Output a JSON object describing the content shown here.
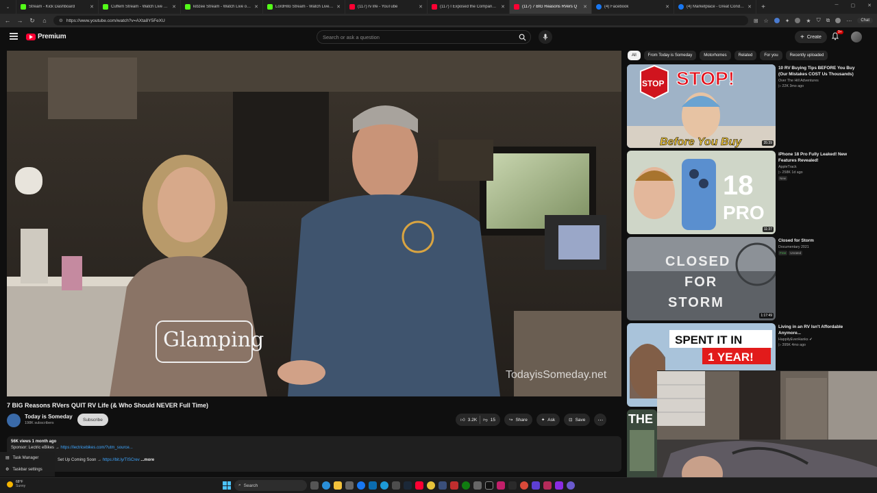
{
  "browser": {
    "tabs": [
      {
        "label": "Stream - Kick Dashboard",
        "fav": "k",
        "active": false
      },
      {
        "label": "Cuffem Stream - Watch Live on Ki",
        "fav": "k",
        "active": false
      },
      {
        "label": "kibzee Stream - Watch Live on Ki",
        "fav": "k",
        "active": false
      },
      {
        "label": "LordHito Stream - Watch Live on",
        "fav": "k",
        "active": false
      },
      {
        "label": "(117) rv life - YouTube",
        "fav": "y",
        "active": false
      },
      {
        "label": "(117) I Exposed the Company Spy",
        "fav": "y",
        "active": false
      },
      {
        "label": "(117) 7 BIG Reasons RVers Q",
        "fav": "y",
        "active": true
      },
      {
        "label": "(4) Facebook",
        "fav": "f",
        "active": false
      },
      {
        "label": "(4) Marketplace - Great Conditio",
        "fav": "f",
        "active": false
      }
    ],
    "url": "https://www.youtube.com/watch?v=AXta8Y5FeXU",
    "chat_label": "Chat"
  },
  "header": {
    "logo_text": "Premium",
    "search_placeholder": "Search or ask a question",
    "create_label": "Create",
    "notif_badge": "9+"
  },
  "video": {
    "watermark": "TodayisSomeday.net",
    "title": "7 BIG Reasons RVers QUIT RV Life (& Who Should NEVER Full Time)",
    "channel": "Today is Someday",
    "subscribers": "198K subscribers",
    "subscribe_label": "Subscribe",
    "likes": "3.2K",
    "dislikes": "15",
    "share_label": "Share",
    "ask_label": "Ask",
    "save_label": "Save"
  },
  "description": {
    "stats": "56K views  1 month ago",
    "line1_text": "Sponsor: Lectric eBikes → ",
    "line1_link": "https://lectricebikes.com/?utm_source...",
    "line2_text": "Set Up Coming Soon → ",
    "line2_link": "https://bit.ly/TISCrev",
    "more_label": "...more"
  },
  "chips": [
    "All",
    "From Today is Someday",
    "Motorhomes",
    "Related",
    "For you",
    "Recently uploaded"
  ],
  "recommendations": [
    {
      "title": "10 RV Buying Tips BEFORE You Buy (Our Mistakes COST Us Thousands)",
      "channel": "Over The Hill Adventures",
      "meta": "22K  3mo ago",
      "duration": "35:39",
      "tags": [],
      "thumb_text_a": "STOP!",
      "thumb_text_b": "Before You Buy",
      "thumb_sign": "STOP"
    },
    {
      "title": "iPhone 18 Pro Fully Leaked! New Features Revealed!",
      "channel": "AppleTrack",
      "meta": "258K  1d ago",
      "duration": "11:37",
      "tags": [
        "New"
      ],
      "thumb_text_a": "18",
      "thumb_text_b": "PRO"
    },
    {
      "title": "Closed for Storm",
      "channel": "Documentary 2021",
      "meta": "",
      "duration": "1:17:49",
      "tags": [
        "Free",
        "Unrated"
      ],
      "thumb_text_a": "CLOSED",
      "thumb_text_b": "FOR",
      "thumb_text_c": "STORM"
    },
    {
      "title": "Living in an RV Isn't Affordable Anymore...",
      "channel": "HappilyEverHanks",
      "meta": "395K  4mo ago",
      "duration": "",
      "tags": [],
      "thumb_text_a": "SPENT IT IN",
      "thumb_text_b": "1 YEAR!"
    },
    {
      "thumb_text_a": "THE"
    }
  ],
  "taskmanager": {
    "item1": "Task Manager",
    "item2": "Taskbar settings"
  },
  "taskbar": {
    "temp": "68°F",
    "condition": "Sunny",
    "search_label": "Search"
  },
  "colors": {
    "yt_red": "#ff0033",
    "link_blue": "#3ea6ff",
    "bg": "#0f0f0f"
  }
}
